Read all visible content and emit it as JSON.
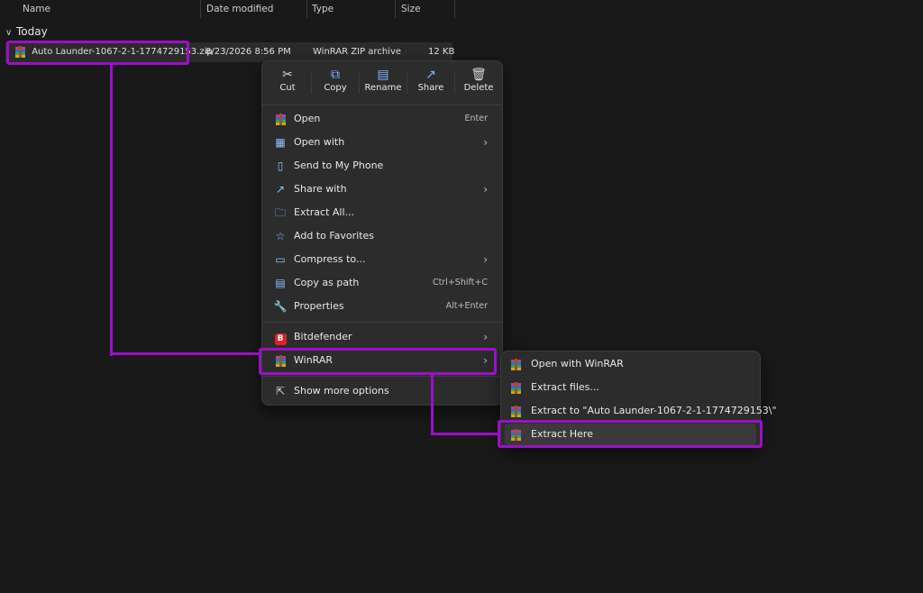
{
  "columns": {
    "name": "Name",
    "date_modified": "Date modified",
    "type": "Type",
    "size": "Size"
  },
  "group": {
    "label": "Today",
    "expanded": true
  },
  "file": {
    "name": "Auto Launder-1067-2-1-1774729153.zip",
    "date_modified": "8/23/2026 8:56 PM",
    "type": "WinRAR ZIP archive",
    "size": "12 KB"
  },
  "toolbar": {
    "cut": "Cut",
    "copy": "Copy",
    "rename": "Rename",
    "share": "Share",
    "delete": "Delete"
  },
  "menu": {
    "open": {
      "label": "Open",
      "shortcut": "Enter"
    },
    "open_with": {
      "label": "Open with"
    },
    "send_to_phone": {
      "label": "Send to My Phone"
    },
    "share_with": {
      "label": "Share with"
    },
    "extract_all": {
      "label": "Extract All..."
    },
    "add_favorites": {
      "label": "Add to Favorites"
    },
    "compress_to": {
      "label": "Compress to..."
    },
    "copy_as_path": {
      "label": "Copy as path",
      "shortcut": "Ctrl+Shift+C"
    },
    "properties": {
      "label": "Properties",
      "shortcut": "Alt+Enter"
    },
    "bitdefender": {
      "label": "Bitdefender"
    },
    "winrar": {
      "label": "WinRAR"
    },
    "show_more": {
      "label": "Show more options"
    }
  },
  "submenu": {
    "open_with_winrar": "Open with WinRAR",
    "extract_files": "Extract files...",
    "extract_to": "Extract to \"Auto Launder-1067-2-1-1774729153\\\"",
    "extract_here": "Extract Here"
  },
  "colors": {
    "highlight": "#9a10c8",
    "background": "#191919",
    "menu": "#2c2c2c",
    "accent_icon": "#8ec1ff",
    "bitdefender": "#e0202a"
  },
  "icons": {
    "cut": "scissors-icon",
    "copy": "copy-icon",
    "rename": "rename-icon",
    "share": "share-icon",
    "delete": "trash-icon"
  }
}
